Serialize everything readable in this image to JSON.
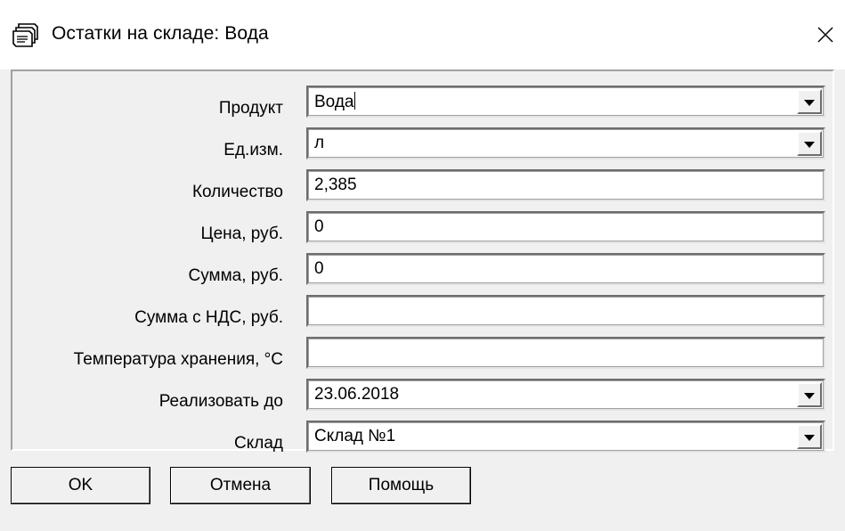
{
  "window": {
    "title": "Остатки на складе: Вода",
    "title_icon": "stacked-windows-icon",
    "close_icon": "close-icon"
  },
  "form": {
    "rows": [
      {
        "label": "Продукт",
        "value": "Вода",
        "type": "combo",
        "focused": true
      },
      {
        "label": "Ед.изм.",
        "value": "л",
        "type": "combo"
      },
      {
        "label": "Количество",
        "value": "2,385",
        "type": "text"
      },
      {
        "label": "Цена, руб.",
        "value": "0",
        "type": "text"
      },
      {
        "label": "Сумма, руб.",
        "value": "0",
        "type": "text"
      },
      {
        "label": "Сумма с НДС, руб.",
        "value": "",
        "type": "text"
      },
      {
        "label": "Температура хранения, °C",
        "value": "",
        "type": "text"
      },
      {
        "label": "Реализовать до",
        "value": "23.06.2018",
        "type": "combo"
      },
      {
        "label": "Склад",
        "value": "Склад №1",
        "type": "combo"
      }
    ]
  },
  "buttons": {
    "ok": "OK",
    "cancel": "Отмена",
    "help": "Помощь"
  }
}
